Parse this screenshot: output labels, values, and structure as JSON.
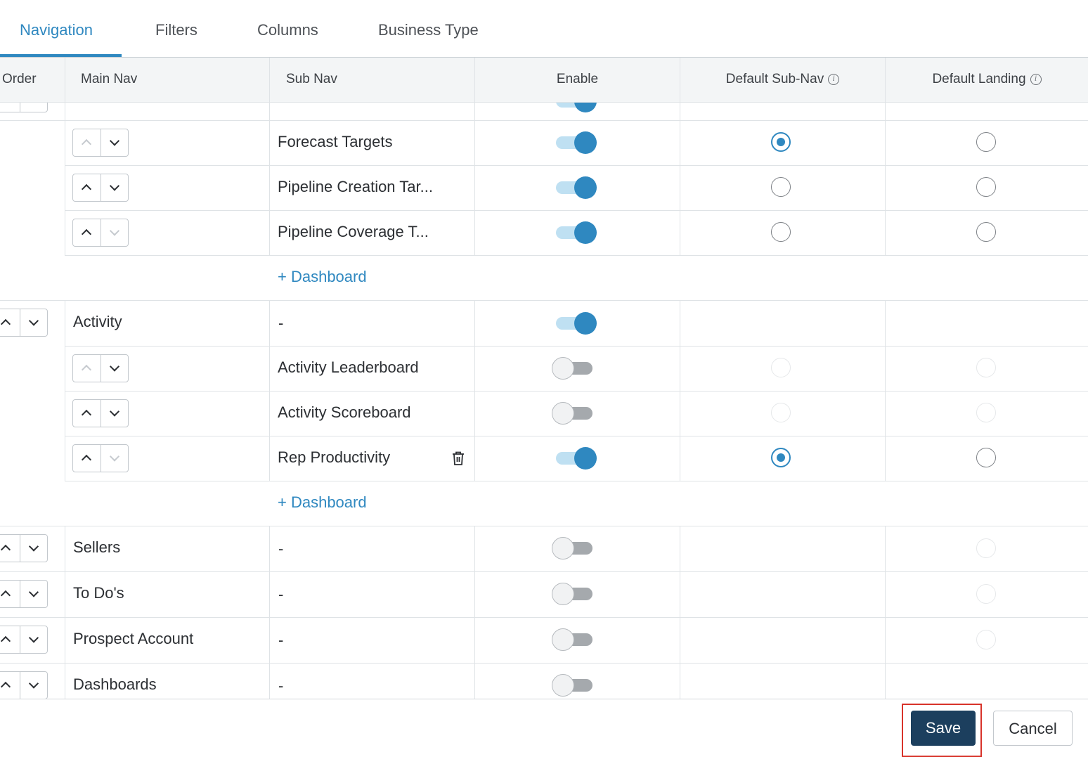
{
  "tabs": [
    {
      "label": "Navigation",
      "active": true
    },
    {
      "label": "Filters",
      "active": false
    },
    {
      "label": "Columns",
      "active": false
    },
    {
      "label": "Business Type",
      "active": false
    }
  ],
  "table": {
    "headers": {
      "order": "Order",
      "main_nav": "Main Nav",
      "sub_nav": "Sub Nav",
      "enable": "Enable",
      "default_sub_nav": "Default Sub-Nav",
      "default_landing": "Default Landing"
    },
    "add_dashboard_label": "+ Dashboard",
    "dash": "-",
    "sub_rows": [
      {
        "name": "Forecast Targets",
        "enabled": true,
        "default_sub_nav": "checked",
        "default_landing": "unchecked",
        "up_enabled": false,
        "down_enabled": true
      },
      {
        "name": "Pipeline Creation Tar...",
        "enabled": true,
        "default_sub_nav": "unchecked",
        "default_landing": "unchecked",
        "up_enabled": true,
        "down_enabled": true
      },
      {
        "name": "Pipeline Coverage T...",
        "enabled": true,
        "default_sub_nav": "unchecked",
        "default_landing": "unchecked",
        "up_enabled": true,
        "down_enabled": false
      },
      {
        "name": "Activity Leaderboard",
        "enabled": false,
        "default_sub_nav": "disabled",
        "default_landing": "disabled",
        "up_enabled": false,
        "down_enabled": true
      },
      {
        "name": "Activity Scoreboard",
        "enabled": false,
        "default_sub_nav": "disabled",
        "default_landing": "disabled",
        "up_enabled": true,
        "down_enabled": true
      },
      {
        "name": "Rep Productivity",
        "enabled": true,
        "default_sub_nav": "checked",
        "default_landing": "unchecked",
        "up_enabled": true,
        "down_enabled": false,
        "deletable": true
      }
    ],
    "main_rows": [
      {
        "name": "Activity",
        "sub_nav": "-",
        "enabled": true
      },
      {
        "name": "Sellers",
        "sub_nav": "-",
        "enabled": false,
        "default_landing": "disabled"
      },
      {
        "name": "To Do's",
        "sub_nav": "-",
        "enabled": false,
        "default_landing": "disabled"
      },
      {
        "name": "Prospect Account",
        "sub_nav": "-",
        "enabled": false,
        "default_landing": "disabled"
      },
      {
        "name": "Dashboards",
        "sub_nav": "-",
        "enabled": false
      }
    ]
  },
  "footer": {
    "save_label": "Save",
    "cancel_label": "Cancel"
  },
  "colors": {
    "accent": "#2f88c0",
    "save_button": "#1c3f5e",
    "highlight": "#d8332a"
  },
  "icons": [
    "info-icon",
    "chevron-up-icon",
    "chevron-down-icon",
    "trash-icon"
  ]
}
